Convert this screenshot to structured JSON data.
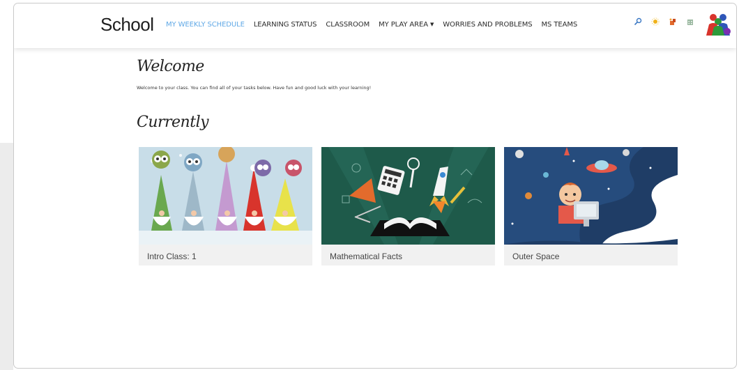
{
  "header": {
    "brand": "School",
    "nav": [
      {
        "label": "MY WEEKLY SCHEDULE",
        "active": true
      },
      {
        "label": "LEARNING STATUS"
      },
      {
        "label": "CLASSROOM"
      },
      {
        "label": "MY PLAY AREA",
        "has_dropdown": true
      },
      {
        "label": "WORRIES AND PROBLEMS"
      },
      {
        "label": "MS TEAMS"
      }
    ],
    "icons": [
      "search-icon",
      "sun-icon",
      "paint-icon",
      "building-icon"
    ],
    "accent_color": "#5fa8e6"
  },
  "main": {
    "welcome": {
      "title": "Welcome",
      "text": "Welcome to your class. You can find all of your tasks below. Have fun and good luck with your learning!"
    },
    "currently": {
      "title": "Currently",
      "cards": [
        {
          "label": "Intro Class: 1"
        },
        {
          "label": "Mathematical Facts"
        },
        {
          "label": "Outer Space"
        }
      ]
    }
  }
}
